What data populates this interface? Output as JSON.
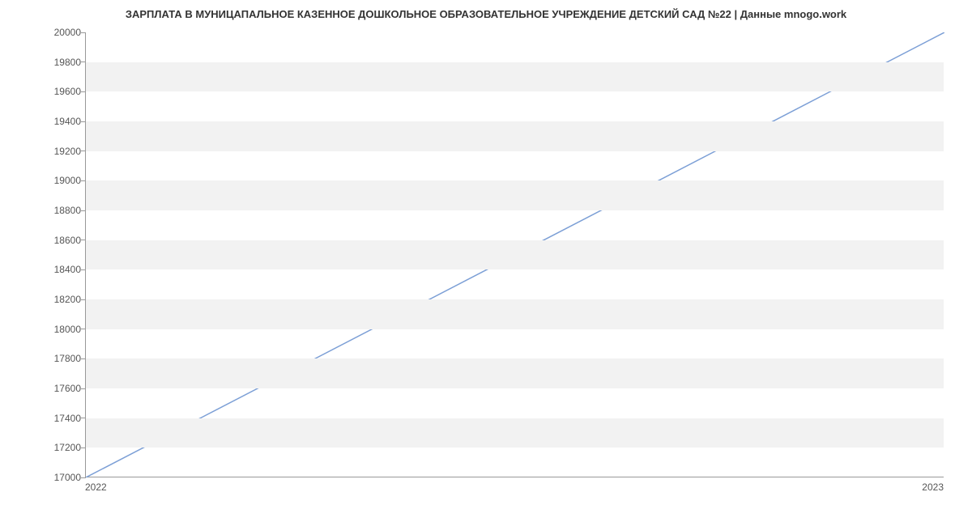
{
  "chart_data": {
    "type": "line",
    "title": "ЗАРПЛАТА В МУНИЦАПАЛЬНОЕ КАЗЕННОЕ ДОШКОЛЬНОЕ ОБРАЗОВАТЕЛЬНОЕ УЧРЕЖДЕНИЕ ДЕТСКИЙ САД №22 | Данные mnogo.work",
    "x": [
      "2022",
      "2023"
    ],
    "values": [
      17000,
      20000
    ],
    "xlabel": "",
    "ylabel": "",
    "ylim": [
      17000,
      20000
    ],
    "yticks": [
      17000,
      17200,
      17400,
      17600,
      17800,
      18000,
      18200,
      18400,
      18600,
      18800,
      19000,
      19200,
      19400,
      19600,
      19800,
      20000
    ],
    "xticks": [
      "2022",
      "2023"
    ],
    "grid": true,
    "line_color": "#7c9fd6"
  }
}
